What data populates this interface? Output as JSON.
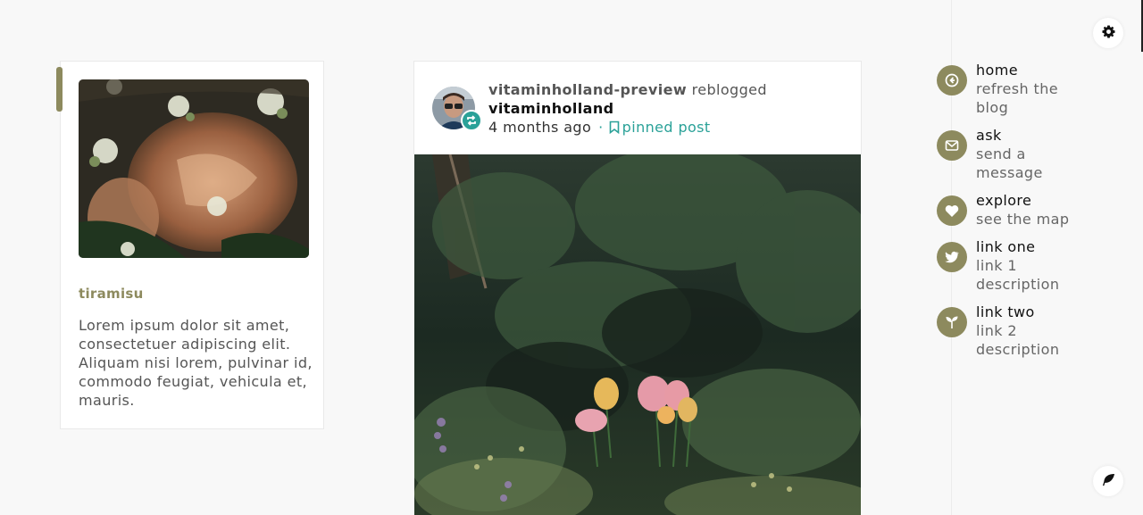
{
  "profile": {
    "title": "tiramisu",
    "description": "Lorem ipsum dolor sit amet, consectetuer adipiscing elit. Aliquam nisi lorem, pulvinar id, commodo feugiat, vehicula et, mauris."
  },
  "post": {
    "rebloger": "vitaminholland-preview",
    "verb": "reblogged",
    "author": "vitaminholland",
    "time": "4 months ago",
    "separator": "·",
    "pinned_label": "pinned post"
  },
  "sidebar": {
    "items": [
      {
        "title": "home",
        "description": "refresh the blog",
        "icon": "arrow-left-icon"
      },
      {
        "title": "ask",
        "description": "send a message",
        "icon": "envelope-icon"
      },
      {
        "title": "explore",
        "description": "see the map",
        "icon": "heart-icon"
      },
      {
        "title": "link one",
        "description": "link 1 description",
        "icon": "bird-icon"
      },
      {
        "title": "link two",
        "description": "link 2 description",
        "icon": "sprout-icon"
      }
    ]
  },
  "colors": {
    "accent": "#8d8a5e",
    "teal": "#2aa198"
  }
}
